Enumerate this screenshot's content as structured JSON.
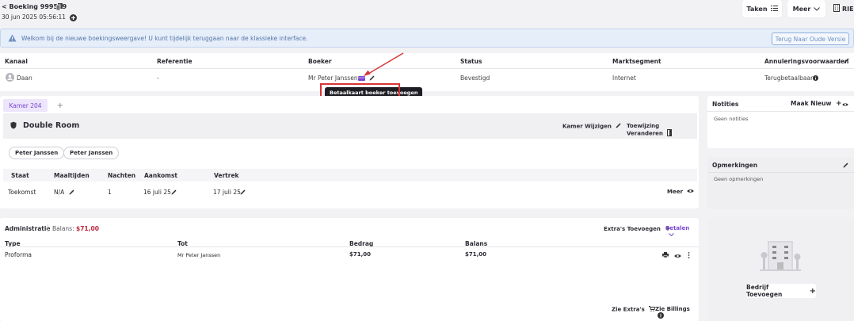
{
  "header": {
    "title": "< Boeking 999509",
    "datetime": "30 jun 2025 05:56:11",
    "buttons": {
      "tasks": "Taken",
      "more": "Meer",
      "org": "RIE"
    }
  },
  "banner": {
    "text": "Welkom bij de nieuwe boekingsweergave! U kunt tijdelijk teruggaan naar de klassieke interface.",
    "button": "Terug Naar Oude Versie"
  },
  "booking_info": {
    "headers": {
      "channel": "Kanaal",
      "reference": "Referentie",
      "booker": "Boeker",
      "status": "Status",
      "segment": "Marktsegment",
      "cancellation": "Annuleringsvoorwaarden"
    },
    "values": {
      "channel": "Daan",
      "reference": "-",
      "booker": "Mr Peter Janssen",
      "status": "Bevestigd",
      "segment": "Internet",
      "cancellation": "Terugbetaalbaar"
    },
    "tooltip": "Betaalkaart boeker toevoegen"
  },
  "room": {
    "tab": "Kamer 204",
    "tab_add": "+",
    "name": "Double Room",
    "actions": {
      "change_room": "Kamer Wijzigen",
      "change_assignment": "Toewijzing Veranderen"
    },
    "guests": [
      "Peter Janssen",
      "Peter Janssen"
    ],
    "stay_headers": {
      "state": "Staat",
      "meals": "Maaltijden",
      "nights": "Nachten",
      "arrival": "Aankomst",
      "departure": "Vertrek"
    },
    "stay_row": {
      "state": "Toekomst",
      "meals": "N/A",
      "nights": "1",
      "arrival": "16 juli 25",
      "departure": "17 juli 25",
      "more": "Meer"
    }
  },
  "admin": {
    "title": "Administratie",
    "balance_label": "Balans:",
    "balance_value": "$71,00",
    "extras_add": "Extra's Toevoegen",
    "pay": "Betalen",
    "columns": {
      "type": "Type",
      "to": "Tot",
      "amount": "Bedrag",
      "balance": "Balans"
    },
    "rows": [
      {
        "type": "Proforma",
        "to": "Mr Peter Janssen",
        "amount": "$71,00",
        "balance": "$71,00"
      }
    ],
    "footer": {
      "see_extras": "Zie Extra's",
      "see_billings": "Zie Billings"
    }
  },
  "notes": {
    "title": "Notities",
    "new": "Maak Nieuw",
    "empty": "Geen notities"
  },
  "remarks": {
    "title": "Opmerkingen",
    "empty": "Geen opmerkingen"
  },
  "company": {
    "button": "Bedrijf Toevoegen"
  },
  "colors": {
    "accent": "#7a45d0",
    "balance": "#c0223a",
    "highlight": "#d83535"
  }
}
